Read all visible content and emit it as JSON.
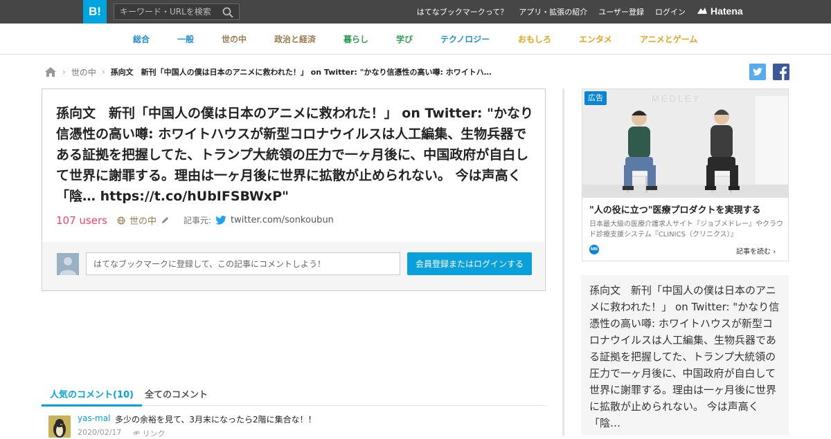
{
  "topbar": {
    "logo": "B!",
    "search_placeholder": "キーワード・URLを検索",
    "links": [
      "はてなブックマークって？",
      "アプリ・拡張の紹介",
      "ユーザー登録",
      "ログイン"
    ],
    "brand": "Hatena"
  },
  "categories": [
    {
      "label": "総合",
      "color": "#1f8ed6"
    },
    {
      "label": "一般",
      "color": "#1f8ed6"
    },
    {
      "label": "世の中",
      "color": "#9b7a4d"
    },
    {
      "label": "政治と経済",
      "color": "#9b7a4d"
    },
    {
      "label": "暮らし",
      "color": "#2f9c54"
    },
    {
      "label": "学び",
      "color": "#2f9c54"
    },
    {
      "label": "テクノロジー",
      "color": "#1f8ed6"
    },
    {
      "label": "おもしろ",
      "color": "#e8a317"
    },
    {
      "label": "エンタメ",
      "color": "#e8a317"
    },
    {
      "label": "アニメとゲーム",
      "color": "#e8a317"
    }
  ],
  "breadcrumb": {
    "section": "世の中",
    "current": "孫向文　新刊「中国人の僕は日本のアニメに救われた！」 on Twitter: \"かなり信憑性の高い噂: ホワイトハ…"
  },
  "entry": {
    "title": "孫向文　新刊「中国人の僕は日本のアニメに救われた！」 on Twitter: \"かなり信憑性の高い噂: ホワイトハウスが新型コロナウイルスは人工編集、生物兵器である証拠を把握してた、トランプ大統領の圧力で一ヶ月後に、中国政府が自白して世界に謝罪する。理由は一ヶ月後に世界に拡散が止められない。 今は声高く「陰… https://t.co/hUbIFSBWxP\"",
    "users": "107 users",
    "category": "世の中",
    "source_label": "記事元:",
    "source": "twitter.com/sonkoubun"
  },
  "comment_form": {
    "placeholder": "はてなブックマークに登録して、この記事にコメントしよう！",
    "button": "会員登録またはログインする"
  },
  "tabs": [
    {
      "label": "人気のコメント(10)",
      "active": true
    },
    {
      "label": "全てのコメント",
      "active": false
    }
  ],
  "comments": [
    {
      "user": "yas-mal",
      "text": "多少の余裕を見て、3月末になったら2階に集合な！！",
      "date": "2020/02/17",
      "link": "リンク"
    }
  ],
  "ad": {
    "badge": "広告",
    "watermark": "MEDLEY",
    "title": "\"人の役に立つ\"医療プロダクトを実現する",
    "desc": "日本最大級の医療介護求人サイト『ジョブメドレー』やクラウド診療支援システム『CLINICS（クリニクス）』",
    "logo": "MM",
    "read_more": "記事を読む"
  },
  "summary": {
    "text": "孫向文　新刊「中国人の僕は日本のアニメに救われた！」 on Twitter: \"かなり信憑性の高い噂: ホワイトハウスが新型コロナウイルスは人工編集、生物兵器である証拠を把握してた、トランプ大統領の圧力で一ヶ月後に、中国政府が自白して世界に謝罪する。理由は一ヶ月後に世界に拡散が止められない。 今は声高く「陰…"
  },
  "social": {
    "twitter_color": "#55acee",
    "facebook_color": "#3b5998"
  }
}
